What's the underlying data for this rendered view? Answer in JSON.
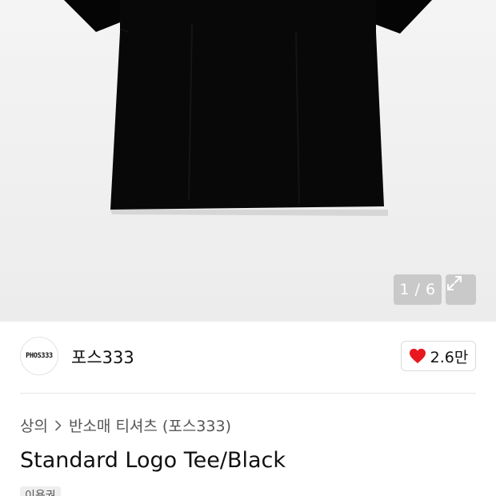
{
  "gallery": {
    "counter": "1 / 6",
    "expand_icon": "expand-arrows-icon"
  },
  "brand": {
    "logo_text": "PHOS333",
    "name": "포스333",
    "like_icon": "heart-icon",
    "like_color": "#e8171f",
    "like_count": "2.6만"
  },
  "breadcrumb": {
    "items": [
      "상의",
      "반소매 티셔츠 (포스333)"
    ],
    "separator_icon": "chevron-right-icon"
  },
  "product": {
    "title": "Standard Logo Tee/Black",
    "tag": "이용권"
  }
}
